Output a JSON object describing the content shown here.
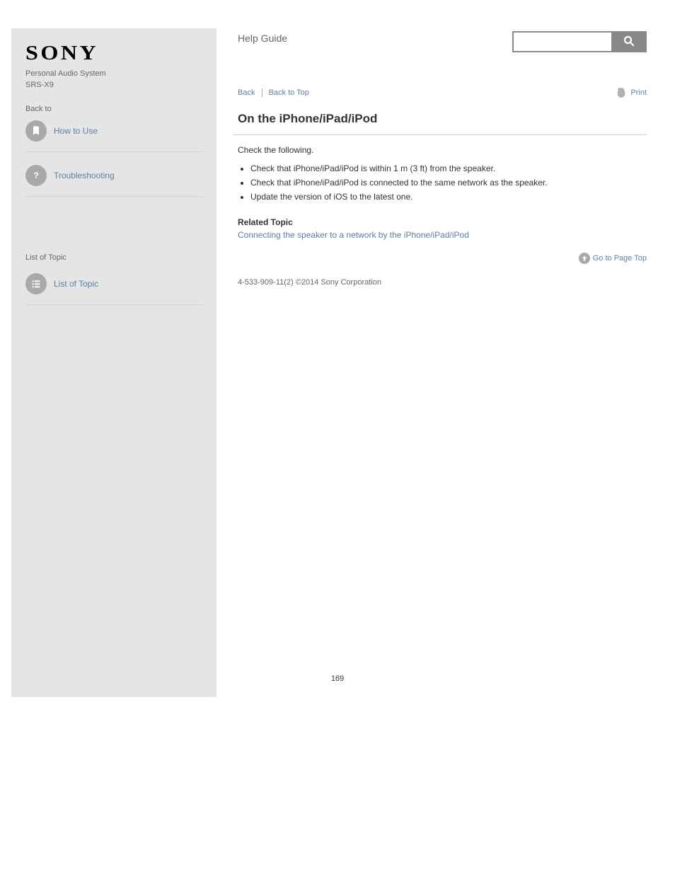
{
  "brand": "SONY",
  "sidebar": {
    "product_name": "Personal Audio System",
    "product_model": "SRS-X9",
    "nav_heading": "Back to",
    "items": [
      {
        "label": "How to Use",
        "icon": "book"
      },
      {
        "label": "Troubleshooting",
        "icon": "question"
      }
    ],
    "list_heading": "List of Topic",
    "list_items": [
      {
        "label": "List of Topic",
        "icon": "list"
      }
    ]
  },
  "header": {
    "title": "Help Guide"
  },
  "breadcrumb": {
    "back": "Back",
    "top": "Back to Top"
  },
  "print": "Print",
  "gotop": "Go to Page Top",
  "article": {
    "title": "On the iPhone/iPad/iPod",
    "intro": "Check the following.",
    "bullets": [
      "Check that iPhone/iPad/iPod is within 1 m (3 ft) from the speaker.",
      "Check that iPhone/iPad/iPod is connected to the same network as the speaker.",
      "Update the version of iOS to the latest one."
    ],
    "related_heading": "Related Topic",
    "related_link": "Connecting the speaker to a network by the iPhone/iPad/iPod"
  },
  "copyright": "4-533-909-11(2) ©2014 Sony Corporation",
  "page_number": "169"
}
